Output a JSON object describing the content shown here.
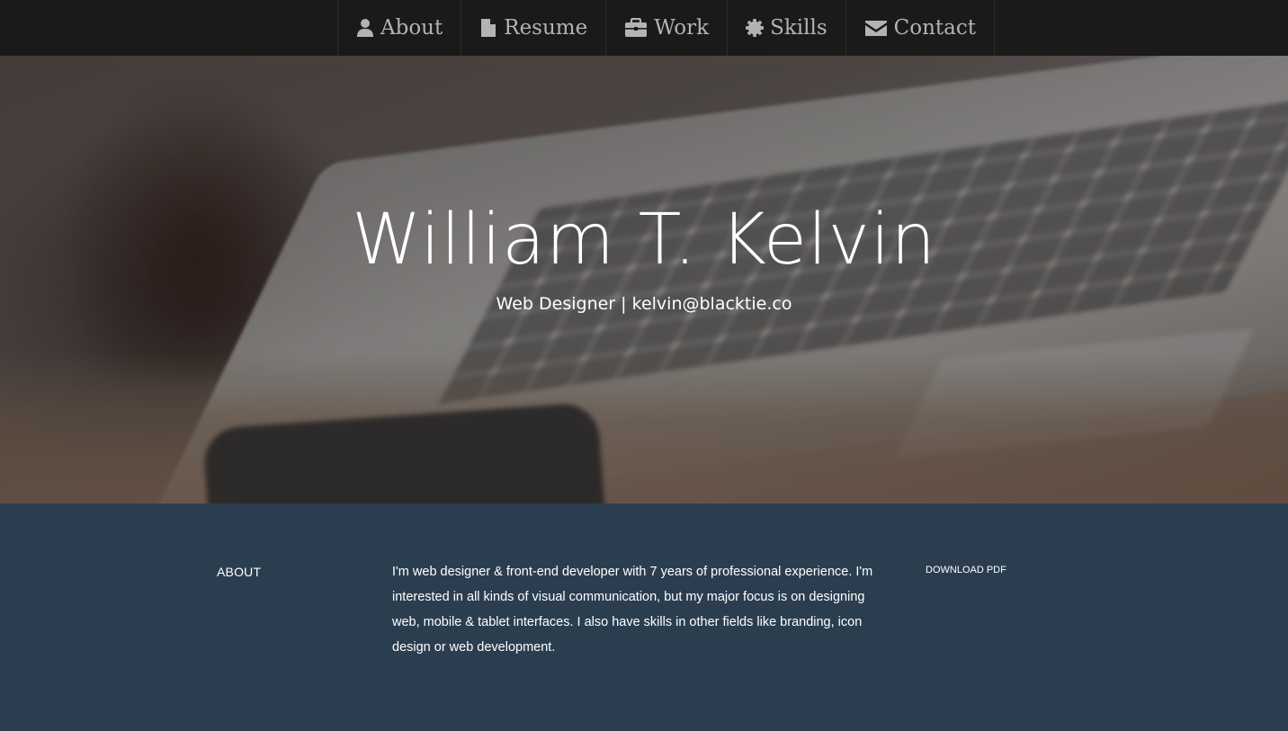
{
  "nav": {
    "items": [
      {
        "label": "About",
        "icon": "user-icon"
      },
      {
        "label": "Resume",
        "icon": "file-icon"
      },
      {
        "label": "Work",
        "icon": "briefcase-icon"
      },
      {
        "label": "Skills",
        "icon": "cog-icon"
      },
      {
        "label": "Contact",
        "icon": "envelope-icon"
      }
    ],
    "text_color": "#b3b3b3",
    "background": "#1a1a1a"
  },
  "hero": {
    "name": "William T. Kelvin",
    "role": "Web Designer",
    "separator": "|",
    "email": "kelvin@blacktie.co"
  },
  "about": {
    "heading": "ABOUT",
    "text": "I'm web designer & front-end developer with 7 years of professional experience. I'm interested in all kinds of visual communication, but my major focus is on designing web, mobile & tablet interfaces. I also have skills in other fields like branding, icon design or web development.",
    "download_label": "DOWNLOAD PDF",
    "background": "#2b3e50"
  }
}
